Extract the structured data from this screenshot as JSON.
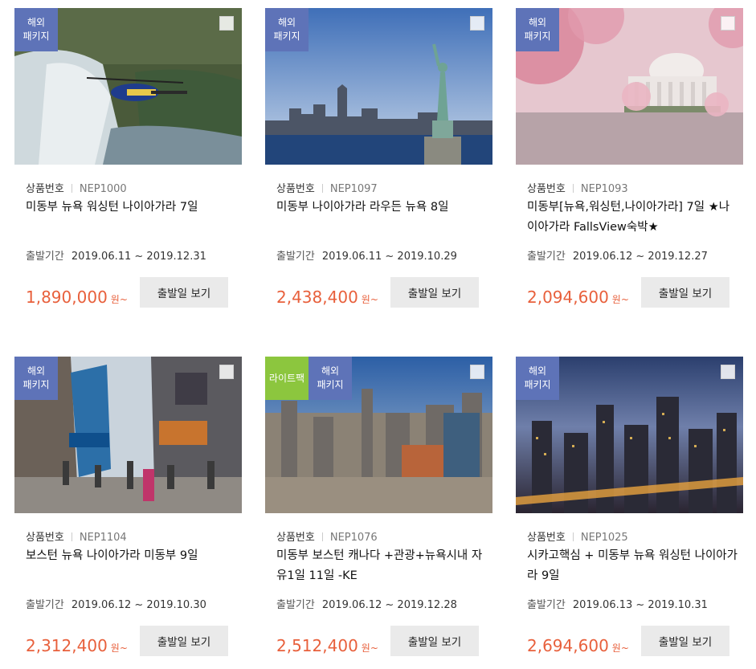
{
  "products": [
    {
      "badges": [
        {
          "text": "해외\n패키지",
          "color": "#5e73b8"
        }
      ],
      "code_label": "상품번호",
      "code": "NEP1000",
      "title": "미동부 뉴욕 워싱턴 나이아가라 7일",
      "period_label": "출발기간",
      "period": "2019.06.11 ~ 2019.12.31",
      "price": "1,890,000",
      "price_unit": "원~",
      "button": "출발일 보기"
    },
    {
      "badges": [
        {
          "text": "해외\n패키지",
          "color": "#5e73b8"
        }
      ],
      "code_label": "상품번호",
      "code": "NEP1097",
      "title": "미동부 나이아가라 라우든 뉴욕 8일",
      "period_label": "출발기간",
      "period": "2019.06.11 ~ 2019.10.29",
      "price": "2,438,400",
      "price_unit": "원~",
      "button": "출발일 보기"
    },
    {
      "badges": [
        {
          "text": "해외\n패키지",
          "color": "#5e73b8"
        }
      ],
      "code_label": "상품번호",
      "code": "NEP1093",
      "title": "미동부[뉴욕,워싱턴,나이아가라] 7일 ★나이아가라 FallsView숙박★",
      "period_label": "출발기간",
      "period": "2019.06.12 ~ 2019.12.27",
      "price": "2,094,600",
      "price_unit": "원~",
      "button": "출발일 보기"
    },
    {
      "badges": [
        {
          "text": "해외\n패키지",
          "color": "#5e73b8"
        }
      ],
      "code_label": "상품번호",
      "code": "NEP1104",
      "title": "보스턴 뉴욕 나이아가라 미동부 9일",
      "period_label": "출발기간",
      "period": "2019.06.12 ~ 2019.10.30",
      "price": "2,312,400",
      "price_unit": "원~",
      "button": "출발일 보기"
    },
    {
      "badges": [
        {
          "text": "라이트팩",
          "color": "#8cc63e"
        },
        {
          "text": "해외\n패키지",
          "color": "#5e73b8"
        }
      ],
      "code_label": "상품번호",
      "code": "NEP1076",
      "title": "미동부 보스턴 캐나다 +관광+뉴욕시내 자유1일 11일 -KE",
      "period_label": "출발기간",
      "period": "2019.06.12 ~ 2019.12.28",
      "price": "2,512,400",
      "price_unit": "원~",
      "button": "출발일 보기"
    },
    {
      "badges": [
        {
          "text": "해외\n패키지",
          "color": "#5e73b8"
        }
      ],
      "code_label": "상품번호",
      "code": "NEP1025",
      "title": "시카고핵심 + 미동부 뉴욕 워싱턴 나이아가라 9일",
      "period_label": "출발기간",
      "period": "2019.06.13 ~ 2019.10.31",
      "price": "2,694,600",
      "price_unit": "원~",
      "button": "출발일 보기"
    }
  ]
}
